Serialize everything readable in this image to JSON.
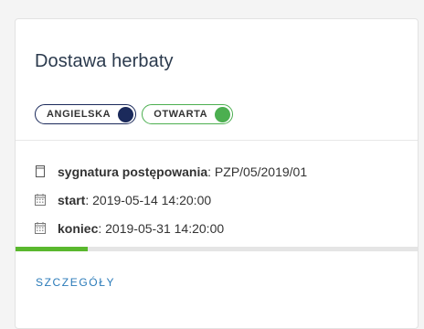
{
  "card": {
    "title": "Dostawa herbaty",
    "badges": [
      {
        "label": "ANGIELSKA",
        "dot_color": "#1b2a5b"
      },
      {
        "label": "OTWARTA",
        "dot_color": "#4caf50"
      }
    ],
    "meta": {
      "signature_label": "sygnatura postępowania",
      "signature_value": ": PZP/05/2019/01",
      "start_label": "start",
      "start_value": ": 2019-05-14 14:20:00",
      "end_label": "koniec",
      "end_value": ": 2019-05-31 14:20:00"
    },
    "progress_fraction": 0.18,
    "details_link": "SZCZEGÓŁY"
  },
  "colors": {
    "accent_green": "#5ab82e",
    "link_blue": "#2b7bb9",
    "navy": "#1b2a5b"
  }
}
